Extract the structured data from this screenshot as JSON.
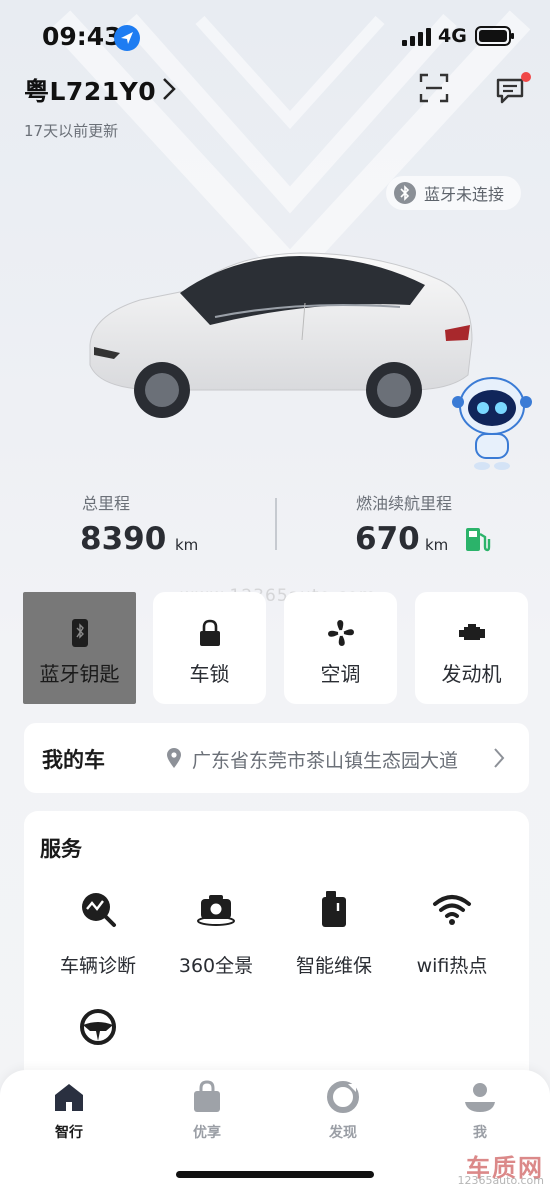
{
  "status_bar": {
    "time": "09:43",
    "network": "4G"
  },
  "header": {
    "plate": "粤L721Y0",
    "updated": "17天以前更新"
  },
  "bluetooth_status": "蓝牙未连接",
  "stats": {
    "mileage": {
      "label": "总里程",
      "value": "8390",
      "unit": "km"
    },
    "range": {
      "label": "燃油续航里程",
      "value": "670",
      "unit": "km"
    }
  },
  "watermark": "www.12365auto.com",
  "controls": [
    {
      "label": "蓝牙钥匙",
      "icon": "bluetooth-key-icon",
      "active": true
    },
    {
      "label": "车锁",
      "icon": "lock-icon"
    },
    {
      "label": "空调",
      "icon": "fan-icon"
    },
    {
      "label": "发动机",
      "icon": "engine-icon"
    }
  ],
  "my_car": {
    "title": "我的车",
    "address": "广东省东莞市茶山镇生态园大道"
  },
  "services": {
    "title": "服务",
    "items": [
      {
        "label": "车辆诊断",
        "icon": "diagnosis-icon"
      },
      {
        "label": "360全景",
        "icon": "camera-360-icon"
      },
      {
        "label": "智能维保",
        "icon": "maintenance-icon"
      },
      {
        "label": "wifi热点",
        "icon": "wifi-icon"
      },
      {
        "label": "",
        "icon": "steering-wheel-icon"
      }
    ]
  },
  "tabs": [
    {
      "label": "智行",
      "icon": "home-icon",
      "active": true
    },
    {
      "label": "优享",
      "icon": "bag-icon"
    },
    {
      "label": "发现",
      "icon": "discover-icon"
    },
    {
      "label": "我",
      "icon": "profile-icon"
    }
  ],
  "corner_mark": {
    "big": "车质网",
    "small": "12365auto.com"
  },
  "colors": {
    "accent_green": "#2bb36a",
    "notification_red": "#f04848",
    "location_blue": "#1d7cf2"
  }
}
